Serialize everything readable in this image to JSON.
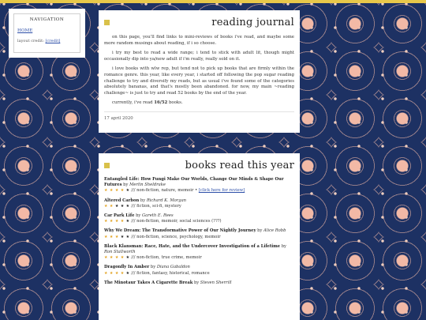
{
  "nav": {
    "title": "NAVIGATION",
    "home": "HOME",
    "credit_prefix": "layout credit:",
    "credit_link": "[credit]"
  },
  "intro": {
    "title": "reading journal",
    "p1": "on this page, you'll find links to mini-reviews of books i've read, and maybe some more random musings about reading, if i so choose.",
    "p2": "i try my best to read a wide range; i tend to stick with adult lit, though might occasionally dip into ya/new adult if i'm really, really sold on it.",
    "p3": "i love books with wlw rep, but tend not to pick up books that are firmly within the romance genre. this year, like every year, i started off following the pop sugar reading challenge to try and diversify my reads, but as usual i've found some of the categories absolutely bananas, and that's mostly been abandoned. for now, my main ~reading challenge~ is just to try and read 52 books by the end of the year.",
    "p4_prefix": "currently, i've read",
    "p4_count": "16/52",
    "p4_suffix": "books.",
    "date": "17 april 2020"
  },
  "books_section": {
    "title": "books read this year",
    "by": "by",
    "tag_sep": "///",
    "books": [
      {
        "title": "Entangled Life: How Fungi Make Our Worlds, Change Our Minds & Shape Our Futures",
        "author": "Merlin Sheldrake",
        "rating": 4,
        "tags": "non-fiction, nature, memoir",
        "link": "[click here for review]"
      },
      {
        "title": "Altered Carbon",
        "author": "Richard K. Morgan",
        "rating": 2,
        "tags": "fiction, sci-fi, mystery",
        "link": ""
      },
      {
        "title": "Car Park Life",
        "author": "Gareth E. Rees",
        "rating": 4,
        "tags": "non-fiction, memoir, social sciences (???)",
        "link": ""
      },
      {
        "title": "Why We Dream: The Transformative Power of Our Nightly Journey",
        "author": "Alice Robb",
        "rating": 3,
        "tags": "non-fiction, science, psychology, memoir",
        "link": ""
      },
      {
        "title": "Black Klansman: Race, Hate, and the Undercover Investigation of a Lifetime",
        "author": "Ron Stallworth",
        "rating": 4,
        "tags": "non-fiction, true crime, memoir",
        "link": ""
      },
      {
        "title": "Dragonfly In Amber",
        "author": "Diana Gabaldon",
        "rating": 4,
        "tags": "fiction, fantasy, historical, romance",
        "link": ""
      },
      {
        "title": "The Minotaur Takes A Cigarette Break",
        "author": "Steven Sherrill",
        "rating": 0,
        "tags": "",
        "link": ""
      }
    ]
  }
}
